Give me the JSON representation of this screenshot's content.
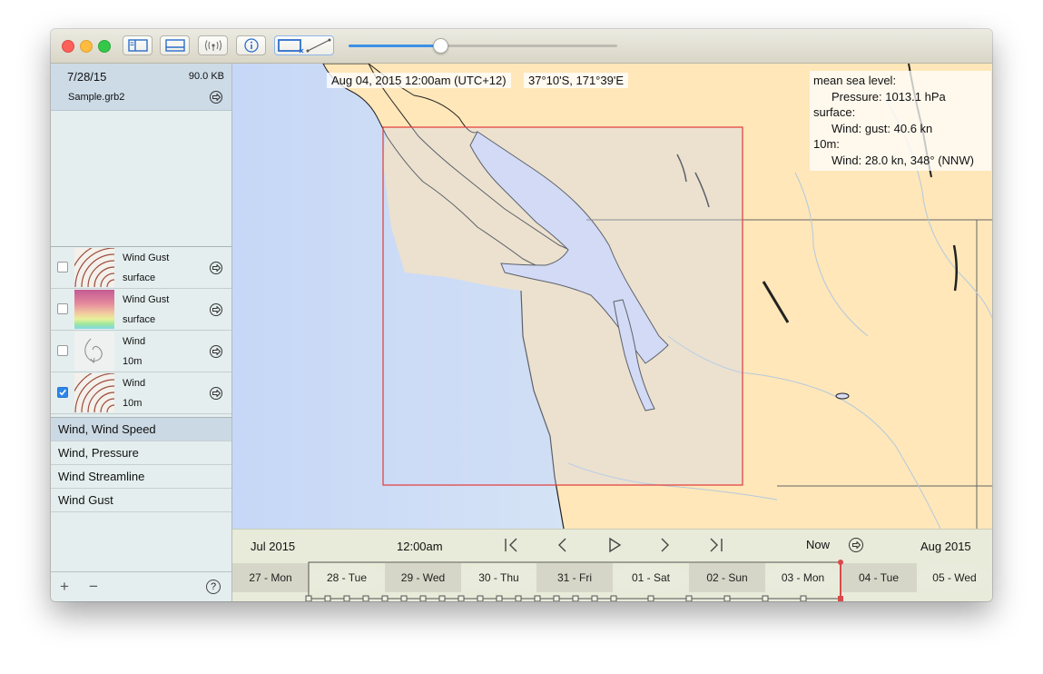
{
  "file": {
    "date": "7/28/15",
    "size": "90.0 KB",
    "name": "Sample.grb2"
  },
  "layers": [
    {
      "name": "Wind Gust",
      "level": "surface",
      "checked": false,
      "thumb": "contour-icon"
    },
    {
      "name": "Wind Gust",
      "level": "surface",
      "checked": false,
      "thumb": "color-gradient-icon"
    },
    {
      "name": "Wind",
      "level": "10m",
      "checked": false,
      "thumb": "streamline-icon"
    },
    {
      "name": "Wind",
      "level": "10m",
      "checked": true,
      "thumb": "contour-icon"
    }
  ],
  "presets": [
    {
      "label": "Wind, Wind Speed",
      "selected": true
    },
    {
      "label": "Wind, Pressure",
      "selected": false
    },
    {
      "label": "Wind Streamline",
      "selected": false
    },
    {
      "label": "Wind Gust",
      "selected": false
    }
  ],
  "sidebar_footer": {
    "add": "+",
    "remove": "−",
    "help": "?"
  },
  "map": {
    "datetime": "Aug 04, 2015 12:00am (UTC+12)",
    "coords": "37°10'S, 171°39'E",
    "info": {
      "l1": "mean sea level:",
      "l2": "Pressure: 1013.1 hPa",
      "l3": "surface:",
      "l4": "Wind: gust: 40.6 kn",
      "l5": "10m:",
      "l6": "Wind: 28.0 kn, 348° (NNW)"
    },
    "colors": {
      "land": "#ffe7b9",
      "water": "#cfdff8",
      "selection": "#e23a3a"
    }
  },
  "timeline": {
    "start_month": "Jul 2015",
    "time": "12:00am",
    "now_label": "Now",
    "end_month": "Aug 2015",
    "days": [
      "27 - Mon",
      "28 - Tue",
      "29 - Wed",
      "30 - Thu",
      "31 - Fri",
      "01 - Sat",
      "02 - Sun",
      "03 - Mon",
      "04 - Tue",
      "05 - Wed"
    ],
    "accent": "#d94a4a"
  },
  "toolbar": {
    "slider_value": 0.34,
    "accent": "#3d8fe6"
  }
}
